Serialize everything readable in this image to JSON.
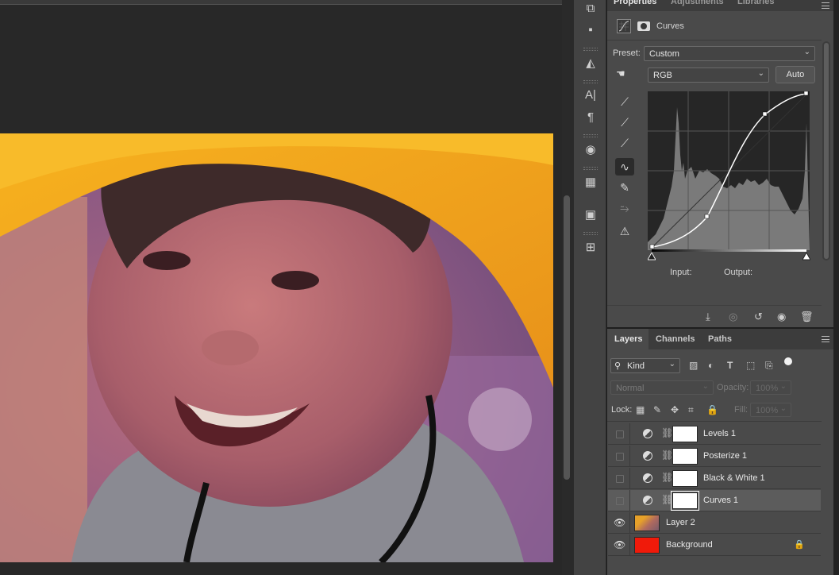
{
  "properties": {
    "tabs": [
      "Properties",
      "Adjustments",
      "Libraries"
    ],
    "header": "Curves",
    "preset_label": "Preset:",
    "preset_value": "Custom",
    "channel_value": "RGB",
    "auto_label": "Auto",
    "input_label": "Input:",
    "output_label": "Output:"
  },
  "layers_panel": {
    "tabs": [
      "Layers",
      "Channels",
      "Paths"
    ],
    "kind_filter": "Kind",
    "blend_mode": "Normal",
    "opacity_label": "Opacity:",
    "opacity_value": "100%",
    "lock_label": "Lock:",
    "fill_label": "Fill:",
    "fill_value": "100%",
    "layers": [
      {
        "name": "Levels 1",
        "visible": false
      },
      {
        "name": "Posterize 1",
        "visible": false
      },
      {
        "name": "Black & White 1",
        "visible": false
      },
      {
        "name": "Curves 1",
        "visible": false,
        "selected": true
      },
      {
        "name": "Layer 2",
        "visible": true
      },
      {
        "name": "Background",
        "visible": true,
        "locked": true
      }
    ]
  },
  "colors": {
    "panel_bg": "#4a4a4a",
    "background_thumb": "#f01a0a",
    "hat": "#f5a51b"
  }
}
